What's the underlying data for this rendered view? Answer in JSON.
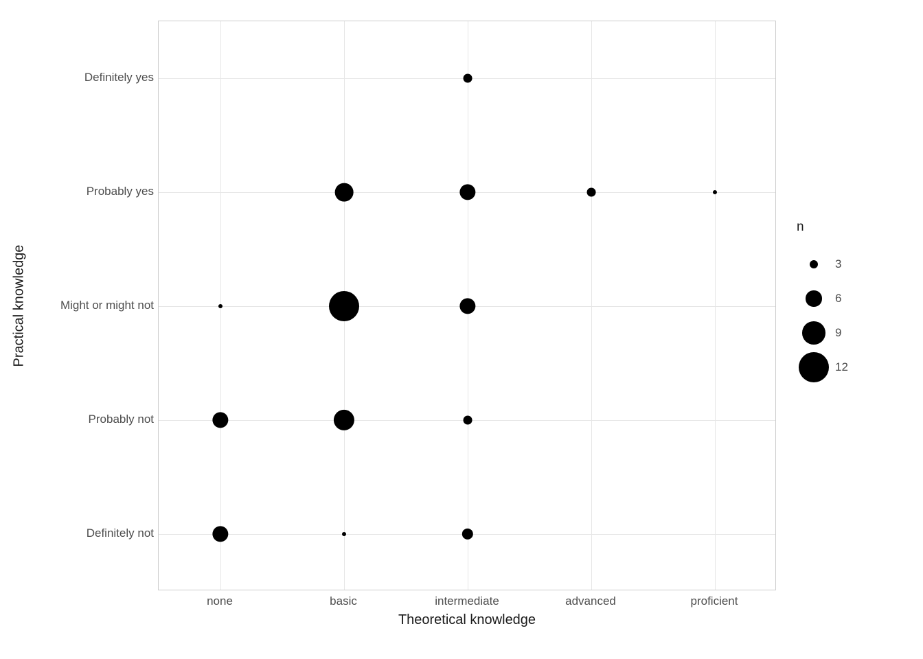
{
  "chart_data": {
    "type": "scatter",
    "xlabel": "Theoretical knowledge",
    "ylabel": "Practical knowledge",
    "x_categories": [
      "none",
      "basic",
      "intermediate",
      "advanced",
      "proficient"
    ],
    "y_categories": [
      "Definitely not",
      "Probably not",
      "Might or might not",
      "Probably yes",
      "Definitely yes"
    ],
    "size_variable": "n",
    "size_breaks": [
      3,
      6,
      9,
      12
    ],
    "points": [
      {
        "x": "none",
        "y": "Definitely not",
        "n": 6
      },
      {
        "x": "basic",
        "y": "Definitely not",
        "n": 1
      },
      {
        "x": "intermediate",
        "y": "Definitely not",
        "n": 4
      },
      {
        "x": "none",
        "y": "Probably not",
        "n": 6
      },
      {
        "x": "basic",
        "y": "Probably not",
        "n": 8
      },
      {
        "x": "intermediate",
        "y": "Probably not",
        "n": 3
      },
      {
        "x": "none",
        "y": "Might or might not",
        "n": 1
      },
      {
        "x": "basic",
        "y": "Might or might not",
        "n": 12
      },
      {
        "x": "intermediate",
        "y": "Might or might not",
        "n": 6
      },
      {
        "x": "basic",
        "y": "Probably yes",
        "n": 7
      },
      {
        "x": "intermediate",
        "y": "Probably yes",
        "n": 6
      },
      {
        "x": "advanced",
        "y": "Probably yes",
        "n": 3
      },
      {
        "x": "proficient",
        "y": "Probably yes",
        "n": 1
      },
      {
        "x": "intermediate",
        "y": "Definitely yes",
        "n": 3
      }
    ]
  },
  "legend": {
    "title": "n",
    "items": [
      {
        "label": "3",
        "n": 3
      },
      {
        "label": "6",
        "n": 6
      },
      {
        "label": "9",
        "n": 9
      },
      {
        "label": "12",
        "n": 12
      }
    ]
  }
}
